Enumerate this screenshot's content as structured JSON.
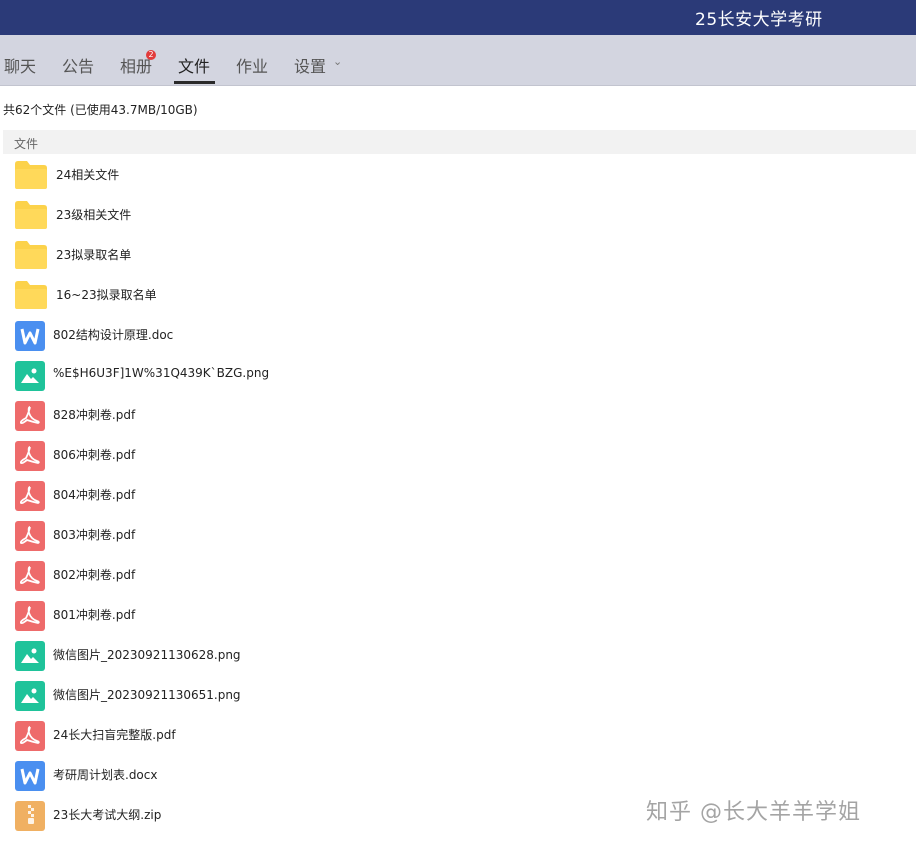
{
  "window": {
    "title": "25长安大学考研"
  },
  "tabs": [
    {
      "label": "聊天"
    },
    {
      "label": "公告"
    },
    {
      "label": "相册",
      "badge": "2"
    },
    {
      "label": "文件",
      "active": true
    },
    {
      "label": "作业"
    },
    {
      "label": "设置"
    }
  ],
  "summary": "共62个文件 (已使用43.7MB/10GB)",
  "column_header": "文件",
  "files": [
    {
      "name": "24相关文件",
      "type": "folder"
    },
    {
      "name": "23级相关文件",
      "type": "folder"
    },
    {
      "name": "23拟录取名单",
      "type": "folder"
    },
    {
      "name": "16~23拟录取名单",
      "type": "folder"
    },
    {
      "name": "802结构设计原理.doc",
      "type": "doc"
    },
    {
      "name": "%E$H6U3F]1W%31Q439K`BZG.png",
      "type": "image"
    },
    {
      "name": "828冲刺卷.pdf",
      "type": "pdf"
    },
    {
      "name": "806冲刺卷.pdf",
      "type": "pdf"
    },
    {
      "name": "804冲刺卷.pdf",
      "type": "pdf"
    },
    {
      "name": "803冲刺卷.pdf",
      "type": "pdf"
    },
    {
      "name": "802冲刺卷.pdf",
      "type": "pdf"
    },
    {
      "name": "801冲刺卷.pdf",
      "type": "pdf"
    },
    {
      "name": "微信图片_20230921130628.png",
      "type": "image"
    },
    {
      "name": "微信图片_20230921130651.png",
      "type": "image"
    },
    {
      "name": "24长大扫盲完整版.pdf",
      "type": "pdf"
    },
    {
      "name": "考研周计划表.docx",
      "type": "doc"
    },
    {
      "name": "23长大考试大纲.zip",
      "type": "zip"
    }
  ],
  "watermark": "知乎 @长大羊羊学姐",
  "colors": {
    "titlebar": "#2b3a78",
    "tabbar": "#d3d5e0",
    "folder": "#fcd24a",
    "doc": "#4a8ff0",
    "image": "#1fc39a",
    "pdf": "#ee6b6b",
    "zip": "#f0b062"
  }
}
